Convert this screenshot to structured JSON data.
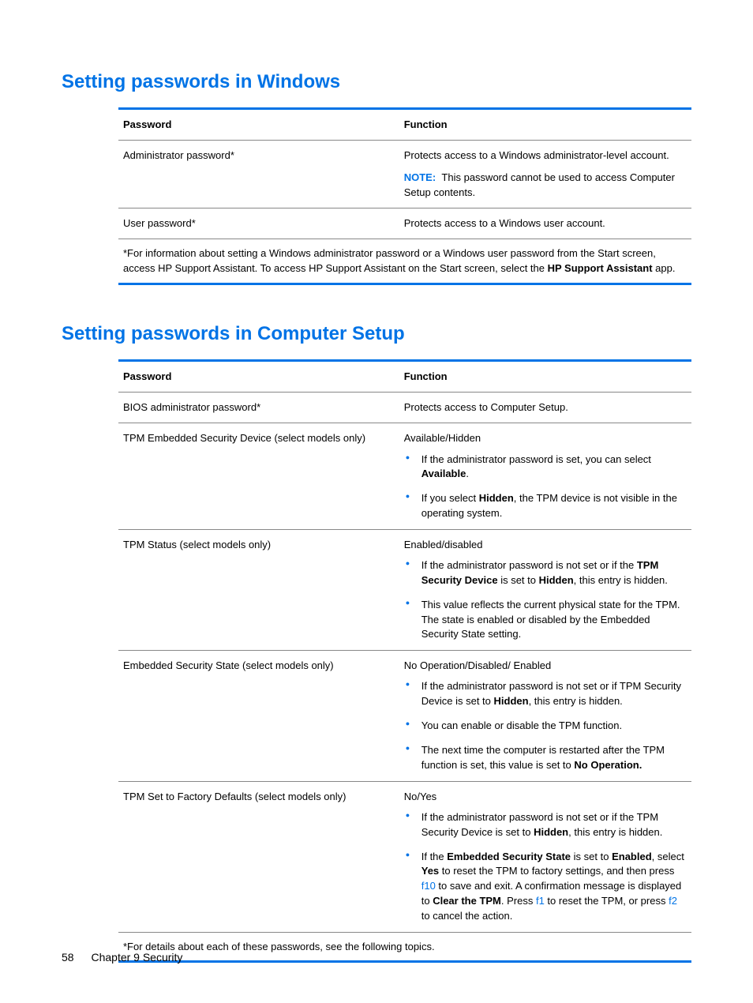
{
  "section1": {
    "heading": "Setting passwords in Windows",
    "header_col1": "Password",
    "header_col2": "Function",
    "row1_col1": "Administrator password*",
    "row1_col2_para1": "Protects access to a Windows administrator-level account.",
    "row1_col2_note_label": "NOTE:",
    "row1_col2_note_text": "This password cannot be used to access Computer Setup contents.",
    "row2_col1": "User password*",
    "row2_col2": "Protects access to a Windows user account.",
    "footnote_prefix": "*For information about setting a Windows administrator password or a Windows user password from the Start screen, access HP Support Assistant. To access HP Support Assistant on the Start screen, select the ",
    "footnote_bold": "HP Support Assistant",
    "footnote_suffix": " app."
  },
  "section2": {
    "heading": "Setting passwords in Computer Setup",
    "header_col1": "Password",
    "header_col2": "Function",
    "row1_col1": "BIOS administrator password*",
    "row1_col2": "Protects access to Computer Setup.",
    "row2_col1": "TPM Embedded Security Device (select models only)",
    "row2_col2_heading": "Available/Hidden",
    "row2_b1_pre": "If the administrator password is set, you can select ",
    "row2_b1_bold": "Available",
    "row2_b1_post": ".",
    "row2_b2_pre": "If you select ",
    "row2_b2_bold": "Hidden",
    "row2_b2_post": ", the TPM device is not visible in the operating system.",
    "row3_col1": "TPM Status (select models only)",
    "row3_col2_heading": "Enabled/disabled",
    "row3_b1_pre": "If the administrator password is not set or if the ",
    "row3_b1_bold1": "TPM Security Device",
    "row3_b1_mid": " is set to ",
    "row3_b1_bold2": "Hidden",
    "row3_b1_post": ", this entry is hidden.",
    "row3_b2": "This value reflects the current physical state for the TPM. The state is enabled or disabled by the Embedded Security State setting.",
    "row4_col1": "Embedded Security State (select models only)",
    "row4_col2_heading": "No Operation/Disabled/ Enabled",
    "row4_b1_pre": "If the administrator password is not set or if TPM Security Device is set to ",
    "row4_b1_bold": "Hidden",
    "row4_b1_post": ", this entry is hidden.",
    "row4_b2": "You can enable or disable the TPM function.",
    "row4_b3_pre": "The next time the computer is restarted after the TPM function is set, this value is set to ",
    "row4_b3_bold": "No Operation.",
    "row5_col1": "TPM Set to Factory Defaults (select models only)",
    "row5_col2_heading": "No/Yes",
    "row5_b1_pre": "If the administrator password is not set or if the TPM Security Device is set to ",
    "row5_b1_bold": "Hidden",
    "row5_b1_post": ", this entry is hidden.",
    "row5_b2_t1": "If the ",
    "row5_b2_bold1": "Embedded Security State",
    "row5_b2_t2": " is set to ",
    "row5_b2_bold2": "Enabled",
    "row5_b2_t3": ", select ",
    "row5_b2_bold3": "Yes",
    "row5_b2_t4": " to reset the TPM to factory settings, and then press ",
    "row5_b2_key1": "f10",
    "row5_b2_t5": " to save and exit. A confirmation message is displayed to ",
    "row5_b2_bold4": "Clear the TPM",
    "row5_b2_t6": ". Press ",
    "row5_b2_key2": "f1",
    "row5_b2_t7": " to reset the TPM, or press ",
    "row5_b2_key3": "f2",
    "row5_b2_t8": " to cancel the action.",
    "footnote": "*For details about each of these passwords, see the following topics."
  },
  "footer": {
    "page": "58",
    "chapter": "Chapter 9   Security"
  }
}
